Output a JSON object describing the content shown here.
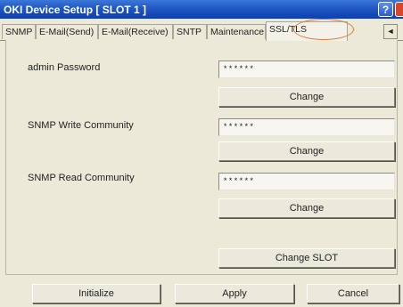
{
  "window": {
    "title": "OKI Device Setup [ SLOT 1 ]",
    "help_label": "?"
  },
  "tabs": [
    {
      "label": "SNMP"
    },
    {
      "label": "E-Mail(Send)"
    },
    {
      "label": "E-Mail(Receive)"
    },
    {
      "label": "SNTP"
    },
    {
      "label": "Maintenance"
    },
    {
      "label": "SSL/TLS",
      "active": true
    }
  ],
  "tab_scroll_label": "◄",
  "form": {
    "admin": {
      "label": "admin Password",
      "value": "******",
      "button": "Change"
    },
    "snmp_write": {
      "label": "SNMP Write Community",
      "value": "******",
      "button": "Change"
    },
    "snmp_read": {
      "label": "SNMP Read Community",
      "value": "******",
      "button": "Change"
    },
    "change_slot_button": "Change SLOT"
  },
  "footer": {
    "initialize": "Initialize",
    "apply": "Apply",
    "cancel": "Cancel"
  },
  "colors": {
    "titlebar": "#1f57c4",
    "highlight_circle": "#e07a3a",
    "dialog_bg": "#ece9d8"
  }
}
